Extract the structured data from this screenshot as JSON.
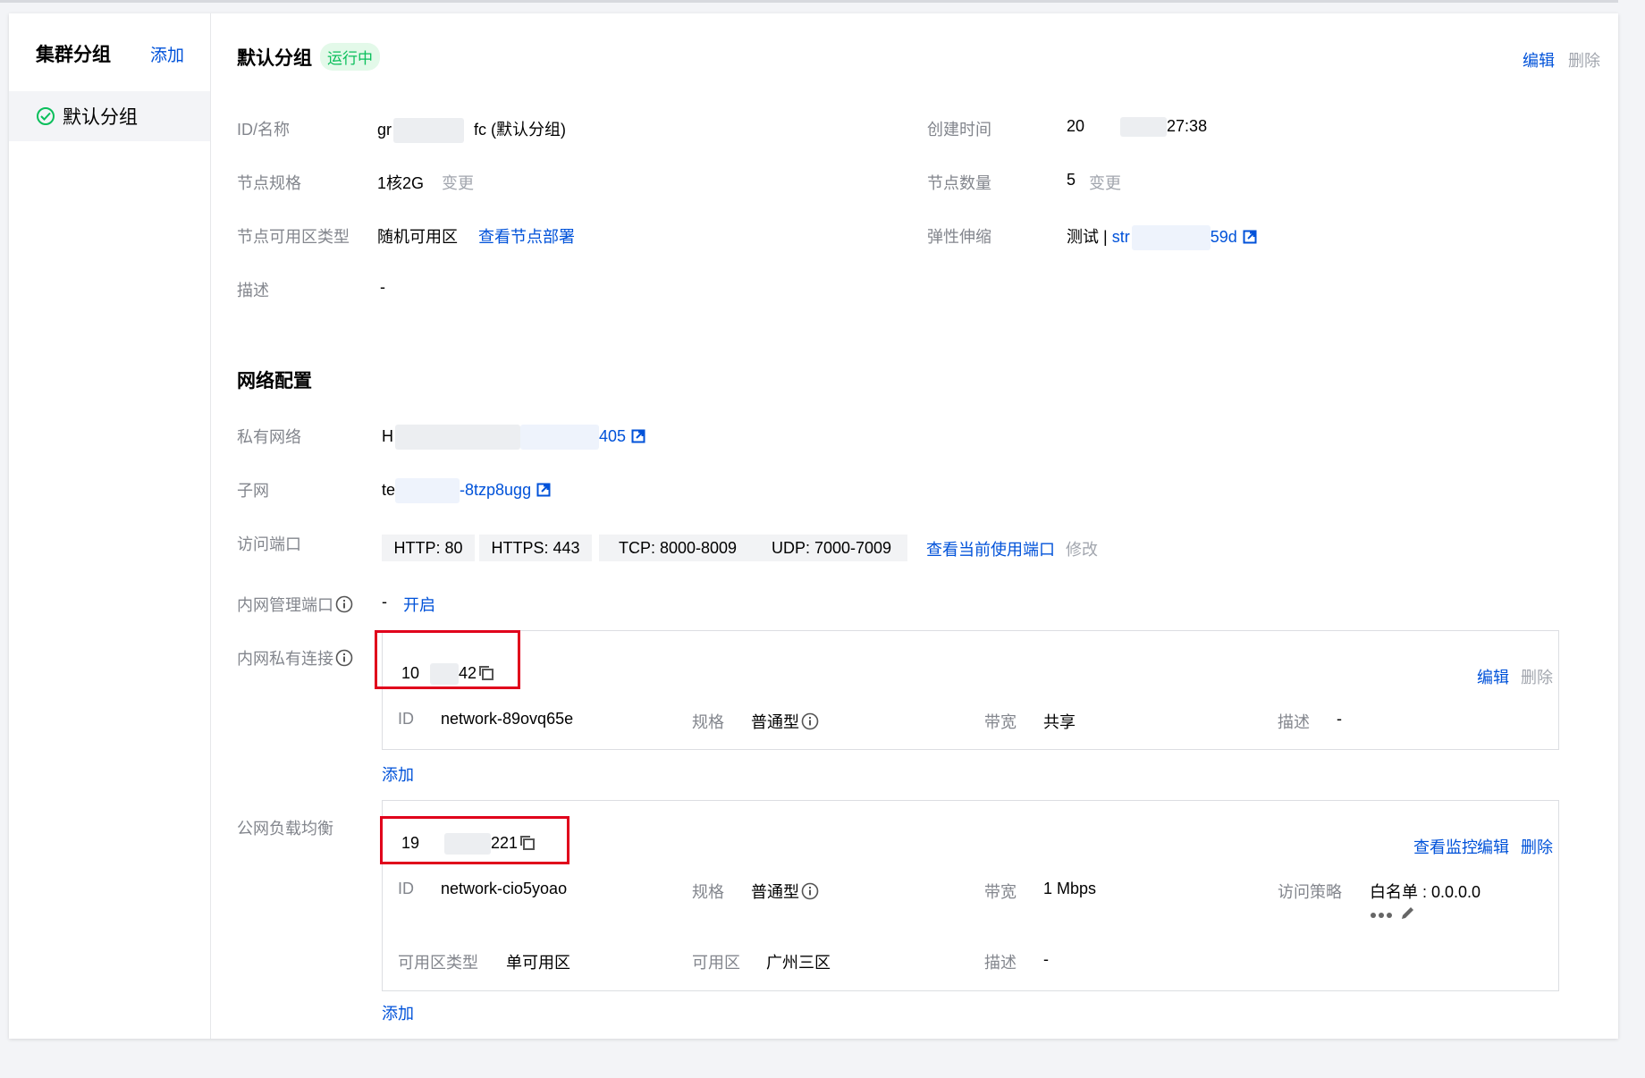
{
  "sidebar": {
    "title": "集群分组",
    "add_label": "添加",
    "items": [
      {
        "label": "默认分组"
      }
    ]
  },
  "header": {
    "title": "默认分组",
    "status": "运行中",
    "edit_label": "编辑",
    "delete_label": "删除"
  },
  "info": {
    "id_name": {
      "label": "ID/名称",
      "prefix": "gr",
      "suffix": "fc (默认分组)"
    },
    "create_time": {
      "label": "创建时间",
      "prefix": "20",
      "suffix": "27:38"
    },
    "node_spec": {
      "label": "节点规格",
      "value": "1核2G",
      "action": "变更"
    },
    "node_count": {
      "label": "节点数量",
      "value": "5",
      "action": "变更"
    },
    "zone_type": {
      "label": "节点可用区类型",
      "value": "随机可用区",
      "link": "查看节点部署"
    },
    "autoscale": {
      "label": "弹性伸缩",
      "value": "测试 |",
      "link_prefix": "str",
      "link_suffix": "59d"
    },
    "desc": {
      "label": "描述",
      "value": "-"
    }
  },
  "network": {
    "section_title": "网络配置",
    "vpc": {
      "label": "私有网络",
      "prefix": "H",
      "suffix": "405"
    },
    "subnet": {
      "label": "子网",
      "prefix": "te",
      "suffix": "-8tzp8ugg"
    },
    "ports": {
      "label": "访问端口",
      "tags": [
        "HTTP: 80",
        "HTTPS: 443",
        "TCP: 8000-8009",
        "UDP: 7000-7009"
      ],
      "link": "查看当前使用端口",
      "modify": "修改"
    },
    "mgmt_port": {
      "label": "内网管理端口",
      "value": "-",
      "action": "开启"
    },
    "private_link": {
      "label": "内网私有连接",
      "ip_prefix": "10",
      "ip_suffix": "42",
      "edit_label": "编辑",
      "delete_label": "删除",
      "id_label": "ID",
      "id_value": "network-89ovq65e",
      "spec_label": "规格",
      "spec_value": "普通型",
      "bw_label": "带宽",
      "bw_value": "共享",
      "desc_label": "描述",
      "desc_value": "-",
      "add_label": "添加"
    },
    "public_lb": {
      "label": "公网负载均衡",
      "ip_prefix": "19",
      "ip_suffix": "221",
      "monitor_label": "查看监控",
      "edit_label": "编辑",
      "delete_label": "删除",
      "id_label": "ID",
      "id_value": "network-cio5yoao",
      "spec_label": "规格",
      "spec_value": "普通型",
      "bw_label": "带宽",
      "bw_value": "1 Mbps",
      "policy_label": "访问策略",
      "policy_value": "白名单 : 0.0.0.0",
      "zonetype_label": "可用区类型",
      "zonetype_value": "单可用区",
      "zone_label": "可用区",
      "zone_value": "广州三区",
      "desc_label": "描述",
      "desc_value": "-",
      "add_label": "添加"
    }
  },
  "colors": {
    "accent": "#0052d9",
    "success": "#0abf5b",
    "highlight": "#e0001b"
  }
}
